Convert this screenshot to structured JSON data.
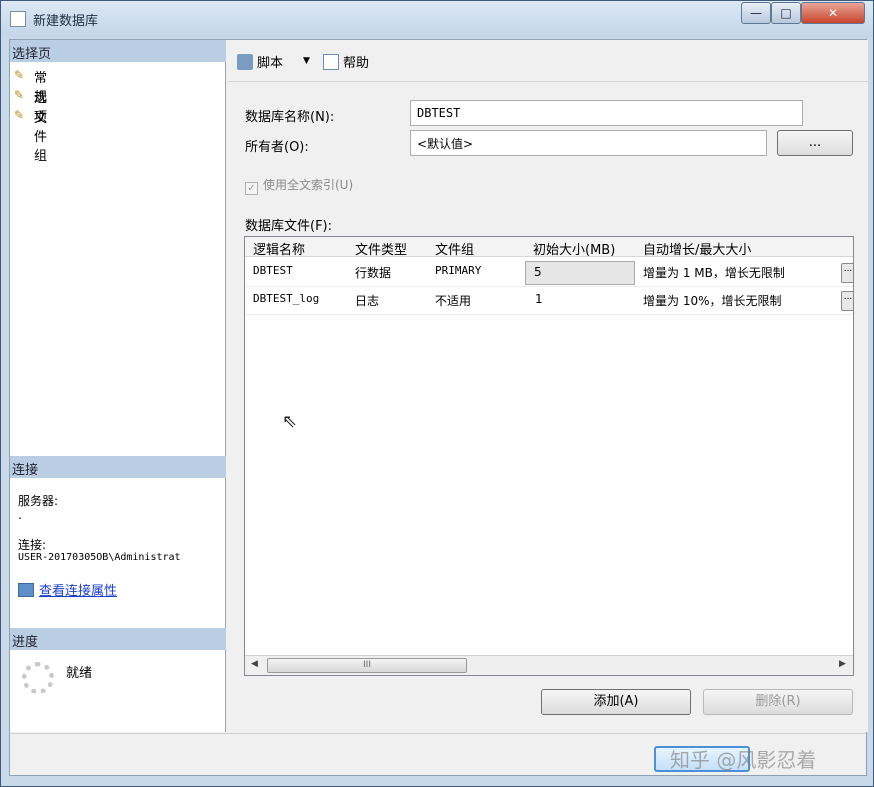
{
  "window": {
    "title": "新建数据库",
    "controls": {
      "minimize": "—",
      "maximize": "□",
      "close": "✕"
    }
  },
  "left_panel": {
    "select_page_header": "选择页",
    "pages": [
      {
        "label": "常规",
        "icon": "page-wrench-icon"
      },
      {
        "label": "选项",
        "icon": "page-wrench-icon"
      },
      {
        "label": "文件组",
        "icon": "page-wrench-icon"
      }
    ],
    "connection_header": "连接",
    "server_label": "服务器:",
    "server_value": ".",
    "connection_label": "连接:",
    "connection_value": "USER-20170305OB\\Administrat",
    "view_properties_link": "查看连接属性",
    "progress_header": "进度",
    "progress_status": "就绪"
  },
  "toolbar": {
    "script_label": "脚本",
    "script_dropdown": "▼",
    "help_label": "帮助"
  },
  "form": {
    "db_name_label": "数据库名称(N):",
    "db_name_value": "DBTEST",
    "owner_label": "所有者(O):",
    "owner_value": "<默认值>",
    "browse_button": "...",
    "fulltext_label": "使用全文索引(U)",
    "fulltext_checked": true,
    "files_label": "数据库文件(F):"
  },
  "grid": {
    "columns": [
      "逻辑名称",
      "文件类型",
      "文件组",
      "初始大小(MB)",
      "自动增长/最大大小"
    ],
    "rows": [
      {
        "name": "DBTEST",
        "type": "行数据",
        "filegroup": "PRIMARY",
        "size": "5",
        "growth": "增量为 1 MB，增长无限制"
      },
      {
        "name": "DBTEST_log",
        "type": "日志",
        "filegroup": "不适用",
        "size": "1",
        "growth": "增量为 10%，增长无限制"
      }
    ],
    "scroll_left": "◀",
    "scroll_right": "▶",
    "scroll_thumb": "III"
  },
  "buttons": {
    "add": "添加(A)",
    "remove": "删除(R)",
    "row_ellipsis": "..."
  },
  "footer": {
    "watermark": "知乎 @风影忍着"
  }
}
